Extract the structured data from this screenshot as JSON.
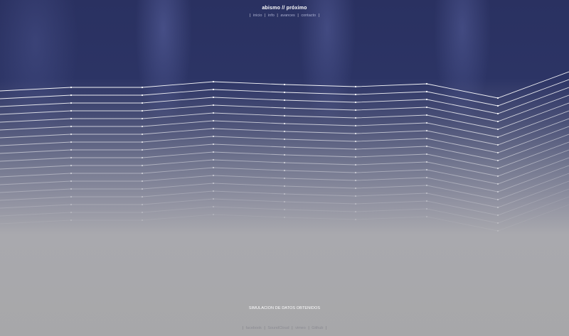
{
  "header": {
    "title": "abismo // próximo",
    "nav": [
      {
        "label": "inicio"
      },
      {
        "label": "info"
      },
      {
        "label": "avances"
      },
      {
        "label": "contacto"
      }
    ]
  },
  "caption": "SIMULACION DE DATOS OBTENIDOS",
  "footer": {
    "links": [
      {
        "label": "facebook"
      },
      {
        "label": "SoundCloud"
      },
      {
        "label": "vimeo"
      },
      {
        "label": "Github"
      }
    ]
  },
  "chart_data": {
    "type": "line",
    "x": [
      0,
      1,
      2,
      3,
      4,
      5,
      6,
      7,
      8
    ],
    "series": [
      {
        "values": [
          128,
          123,
          123,
          115,
          119,
          122,
          118,
          138,
          101
        ]
      },
      {
        "values": [
          139,
          134,
          134,
          126,
          130,
          133,
          129,
          149,
          112
        ]
      },
      {
        "values": [
          150,
          145,
          145,
          137,
          141,
          144,
          140,
          160,
          123
        ]
      },
      {
        "values": [
          161,
          156,
          156,
          148,
          152,
          155,
          151,
          171,
          134
        ]
      },
      {
        "values": [
          172,
          167,
          167,
          159,
          163,
          166,
          162,
          182,
          145
        ]
      },
      {
        "values": [
          183,
          178,
          178,
          170,
          174,
          177,
          173,
          193,
          156
        ]
      },
      {
        "values": [
          194,
          189,
          189,
          181,
          185,
          188,
          184,
          204,
          167
        ]
      },
      {
        "values": [
          205,
          200,
          200,
          192,
          196,
          199,
          195,
          215,
          178
        ]
      },
      {
        "values": [
          216,
          211,
          211,
          203,
          207,
          210,
          206,
          226,
          189
        ]
      },
      {
        "values": [
          227,
          222,
          222,
          214,
          218,
          221,
          217,
          237,
          200
        ]
      },
      {
        "values": [
          238,
          233,
          233,
          225,
          229,
          232,
          228,
          248,
          211
        ]
      },
      {
        "values": [
          249,
          244,
          244,
          236,
          240,
          243,
          239,
          259,
          222
        ]
      },
      {
        "values": [
          260,
          255,
          255,
          247,
          251,
          254,
          250,
          270,
          233
        ]
      },
      {
        "values": [
          271,
          266,
          266,
          258,
          262,
          265,
          261,
          281,
          244
        ]
      },
      {
        "values": [
          282,
          277,
          277,
          269,
          273,
          276,
          272,
          292,
          255
        ]
      },
      {
        "values": [
          293,
          288,
          288,
          280,
          284,
          287,
          283,
          303,
          266
        ]
      },
      {
        "values": [
          304,
          299,
          299,
          291,
          295,
          298,
          294,
          314,
          277
        ]
      },
      {
        "values": [
          315,
          310,
          310,
          302,
          306,
          309,
          305,
          325,
          288
        ]
      }
    ],
    "colors": {
      "line": "#ffffff",
      "point": "#ffffff"
    }
  }
}
